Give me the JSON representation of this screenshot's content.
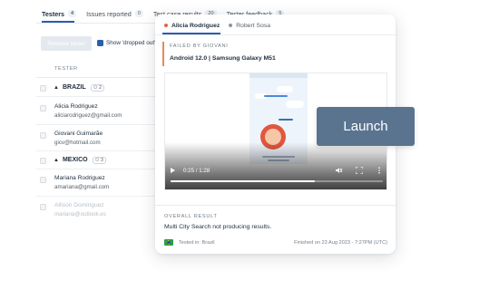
{
  "background": {
    "tabs": [
      {
        "label": "Testers",
        "count": "4",
        "active": true
      },
      {
        "label": "Issues reported",
        "count": "0"
      },
      {
        "label": "Test case results",
        "count": "20"
      },
      {
        "label": "Tester feedback",
        "count": "5"
      }
    ],
    "remove_button": "Remove tester",
    "show_dropped_label": "Show 'dropped out'",
    "column_header": "TESTER",
    "groups": [
      {
        "country": "BRAZIL",
        "count": "2"
      },
      {
        "country": "MEXICO",
        "count": "3"
      }
    ],
    "testers": [
      {
        "name": "Alicia Rodriguez",
        "email": "aliciarodriguez@gmail.com"
      },
      {
        "name": "Giovani Guimarãe",
        "email": "gicv@hotmail.com"
      },
      {
        "name": "Mariana Rodriguez",
        "email": "amariana@gmail.com"
      },
      {
        "name": "Allison Dominguez",
        "email": "mariana@outlook.es"
      }
    ]
  },
  "card": {
    "tabs": [
      {
        "label": "Alicia Rodriguez",
        "dot_color": "#e5634a",
        "active": true
      },
      {
        "label": "Robert Sosa",
        "dot_color": "#8a96a3"
      }
    ],
    "failed_label": "FAILED BY GIOVANI",
    "device": "Android 12.0 | Samsung Galaxy M51",
    "video": {
      "current_time": "0:25",
      "duration": "1:28",
      "time_text": "0:25 / 1:28",
      "progress": 0.68
    },
    "overall_result_label": "OVERALL RESULT",
    "overall_result_text": "Multi City Search not producing results.",
    "tested_in": "Tested in: Brazil",
    "finished": "Finished on 23 Aug 2023 - 7:27PM (UTC)"
  },
  "launch_label": "Launch",
  "colors": {
    "accent": "#2a5db0",
    "launch_bg": "#5a7490",
    "failed_border": "#e58a5c"
  }
}
